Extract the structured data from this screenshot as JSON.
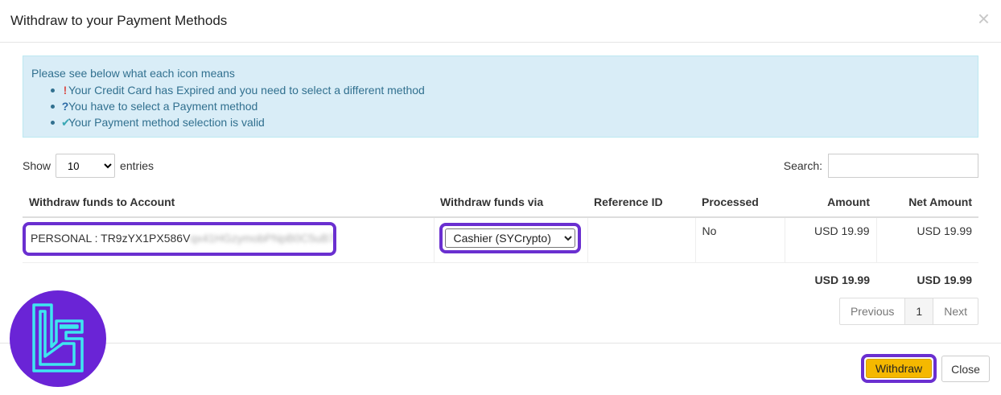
{
  "dialog": {
    "title": "Withdraw to your Payment Methods"
  },
  "info": {
    "intro": "Please see below what each icon means",
    "items": [
      {
        "icon": "exclamation-icon",
        "glyph": "!",
        "text": "Your Credit Card has Expired and you need to select a different method"
      },
      {
        "icon": "question-icon",
        "glyph": "?",
        "text": "You have to select a Payment method"
      },
      {
        "icon": "check-icon",
        "glyph": "✔",
        "text": "Your Payment method selection is valid"
      }
    ]
  },
  "length": {
    "show_label": "Show",
    "value": "10",
    "entries_label": "entries"
  },
  "search": {
    "label": "Search:",
    "value": ""
  },
  "table": {
    "headers": [
      "Withdraw funds to Account",
      "Withdraw funds via",
      "Reference ID",
      "Processed",
      "Amount",
      "Net Amount"
    ],
    "rows": [
      {
        "account": "PERSONAL : TR9zYX1PX586V",
        "account_hidden": "qx41HGzymobPNpB0C5uB7",
        "via": "Cashier (SYCrypto)",
        "reference": "",
        "processed": "No",
        "amount": "USD 19.99",
        "net_amount": "USD 19.99"
      }
    ],
    "totals": {
      "amount": "USD 19.99",
      "net_amount": "USD 19.99"
    }
  },
  "pagination": {
    "previous": "Previous",
    "current": "1",
    "next": "Next"
  },
  "footer": {
    "withdraw_label": "Withdraw",
    "close_label": "Close"
  },
  "colors": {
    "highlight": "#6a2fd0",
    "withdraw_button": "#f5b800",
    "info_bg": "#d9edf7",
    "logo_bg": "#6a24d6",
    "logo_stroke": "#3ee6f0"
  }
}
